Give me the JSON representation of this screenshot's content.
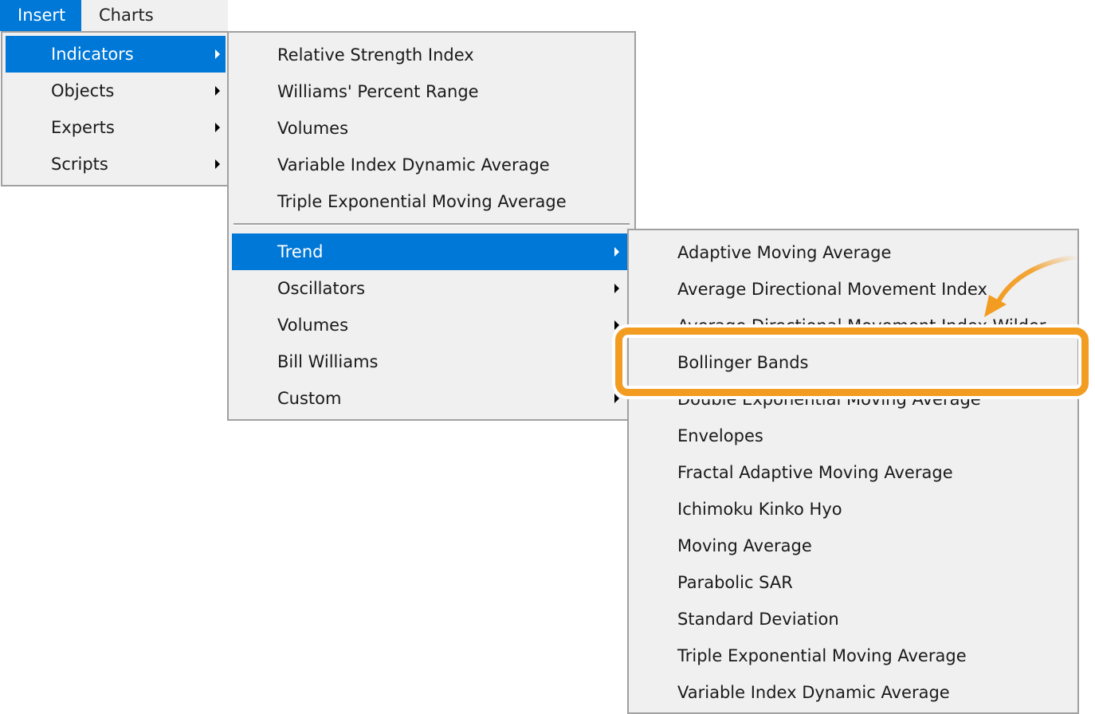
{
  "menubar": {
    "items": [
      {
        "label": "Insert",
        "active": true
      },
      {
        "label": "Charts",
        "active": false
      }
    ]
  },
  "insert_menu": {
    "items": [
      {
        "label": "Indicators",
        "submenu": true,
        "highlighted": true
      },
      {
        "label": "Objects",
        "submenu": true
      },
      {
        "label": "Experts",
        "submenu": true
      },
      {
        "label": "Scripts",
        "submenu": true
      }
    ]
  },
  "indicators_menu": {
    "recent": [
      "Relative Strength Index",
      "Williams' Percent Range",
      "Volumes",
      "Variable Index Dynamic Average",
      "Triple Exponential Moving Average"
    ],
    "categories": [
      {
        "label": "Trend",
        "submenu": true,
        "highlighted": true
      },
      {
        "label": "Oscillators",
        "submenu": true
      },
      {
        "label": "Volumes",
        "submenu": true
      },
      {
        "label": "Bill Williams",
        "submenu": false
      },
      {
        "label": "Custom",
        "submenu": true
      }
    ]
  },
  "trend_menu": {
    "items": [
      "Adaptive Moving Average",
      "Average Directional Movement Index",
      "Average Directional Movement Index Wilder",
      "Bollinger Bands",
      "Double Exponential Moving Average",
      "Envelopes",
      "Fractal Adaptive Moving Average",
      "Ichimoku Kinko Hyo",
      "Moving Average",
      "Parabolic SAR",
      "Standard Deviation",
      "Triple Exponential Moving Average",
      "Variable Index Dynamic Average"
    ],
    "annotated_item": "Bollinger Bands"
  },
  "annotation": {
    "color": "#f39c22",
    "type": "highlight-box-with-arrow"
  },
  "colors": {
    "selection": "#0078d7",
    "menu_bg": "#f0f0f0",
    "border": "#a0a0a0"
  }
}
